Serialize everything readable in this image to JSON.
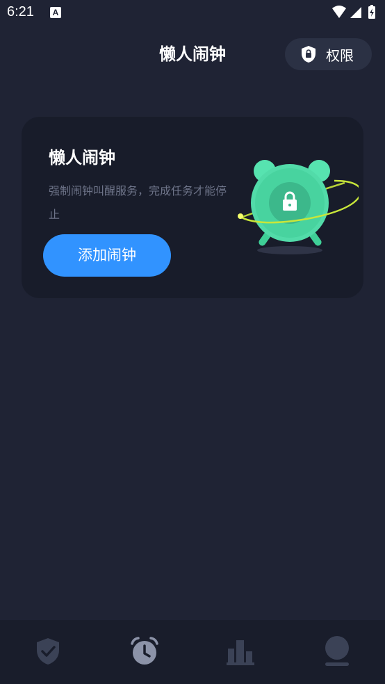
{
  "status_bar": {
    "time": "6:21",
    "notification_icon_letter": "A"
  },
  "header": {
    "title": "懒人闹钟",
    "permission_button_label": "权限"
  },
  "card": {
    "title": "懒人闹钟",
    "description": "强制闹钟叫醒服务，完成任务才能停止",
    "add_button_label": "添加闹钟"
  },
  "bottom_nav": {
    "items": [
      {
        "icon": "shield-check-icon",
        "active": false
      },
      {
        "icon": "alarm-clock-icon",
        "active": true
      },
      {
        "icon": "bar-chart-icon",
        "active": false
      },
      {
        "icon": "profile-icon",
        "active": false
      }
    ]
  },
  "colors": {
    "background": "#1f2334",
    "card": "#181c2a",
    "accent_blue": "#3193ff",
    "illustration_green": "#4fdca6",
    "nav_inactive": "#3b4256",
    "nav_active": "#8c93a8"
  }
}
